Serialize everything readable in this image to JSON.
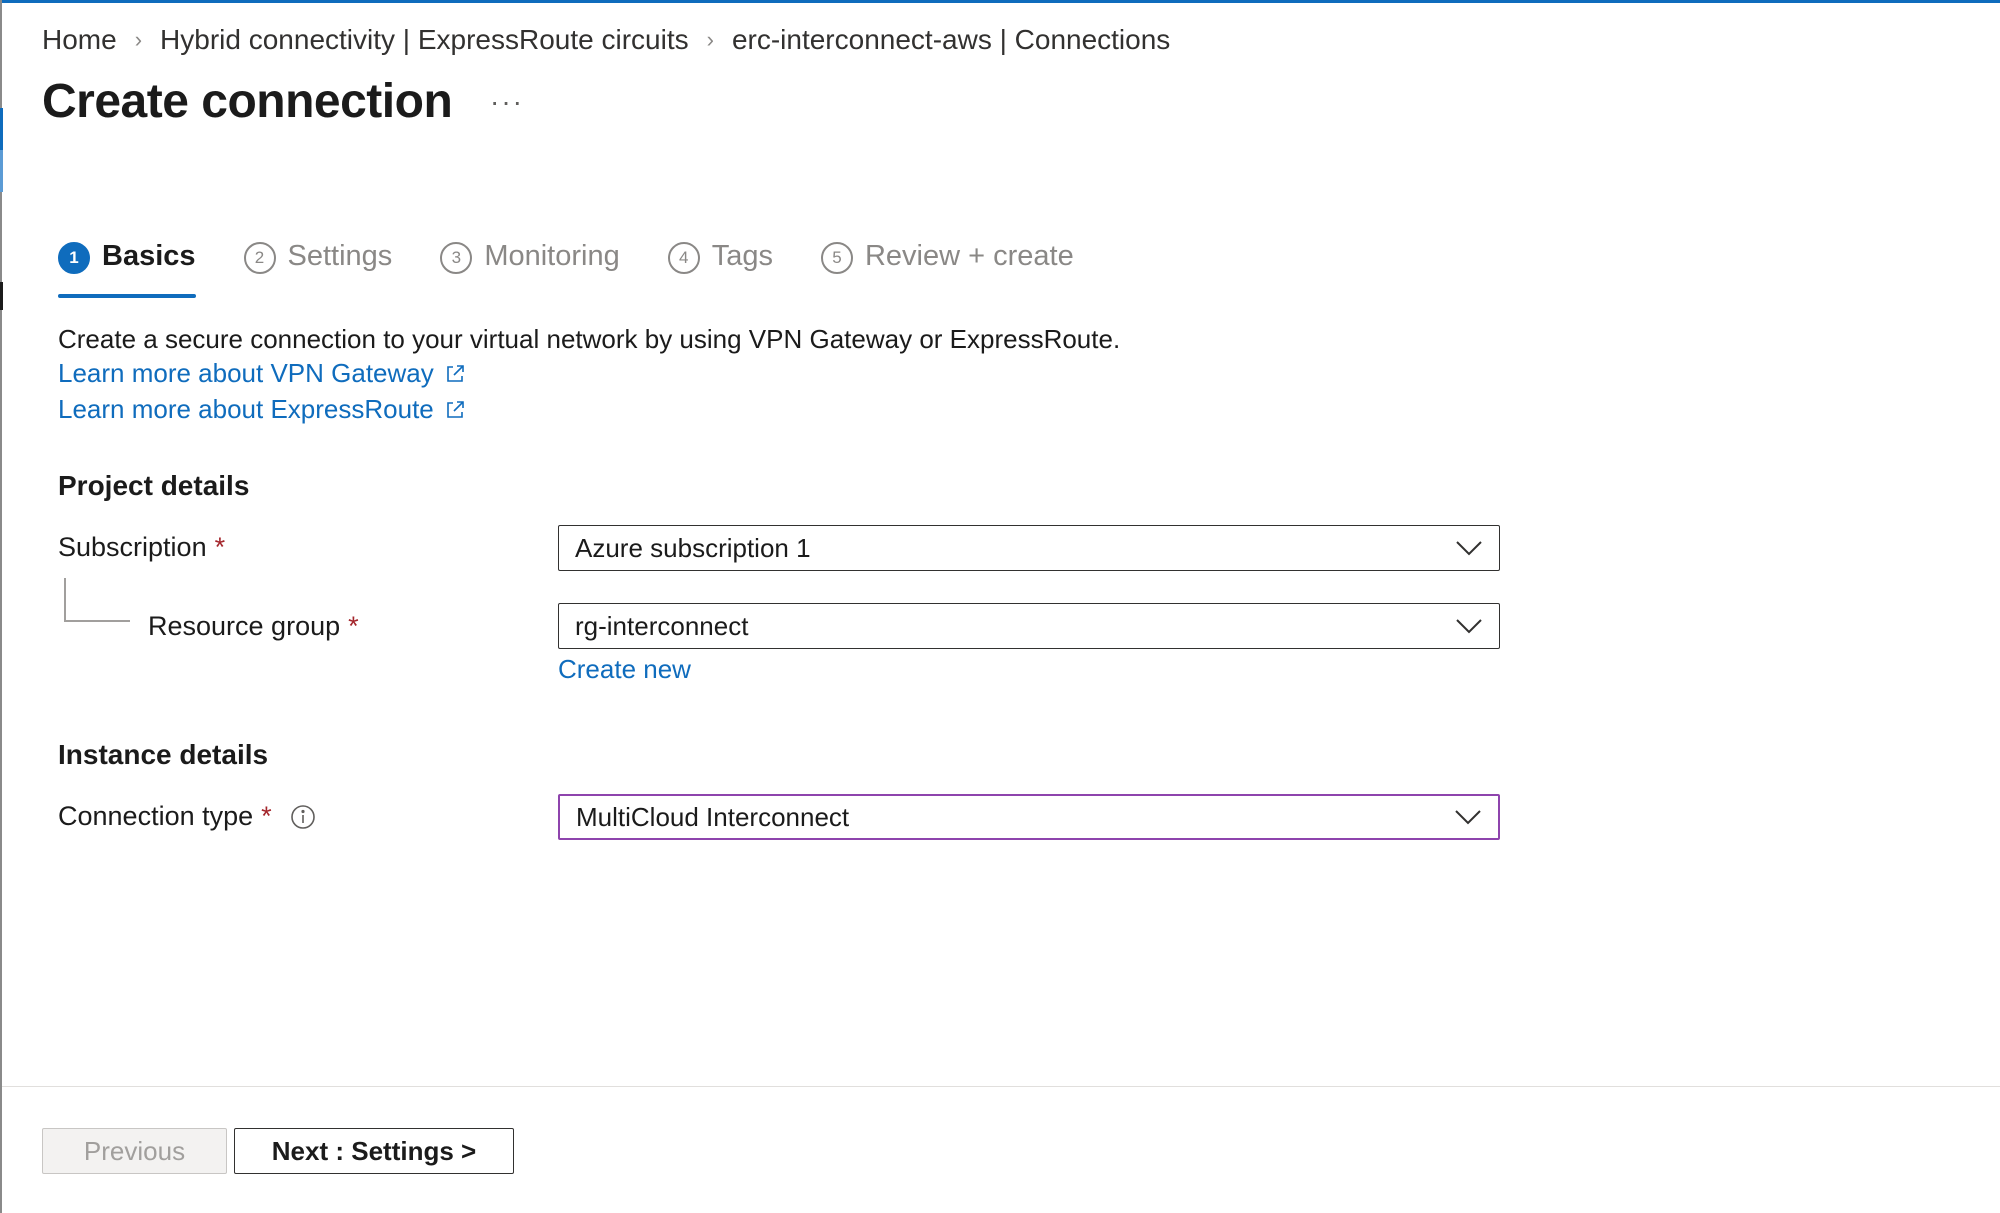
{
  "breadcrumb": {
    "items": [
      "Home",
      "Hybrid connectivity | ExpressRoute circuits",
      "erc-interconnect-aws | Connections"
    ],
    "separator": "›"
  },
  "page": {
    "title": "Create connection",
    "more_label": "···"
  },
  "tabs": [
    {
      "number": "1",
      "label": "Basics",
      "active": true
    },
    {
      "number": "2",
      "label": "Settings",
      "active": false
    },
    {
      "number": "3",
      "label": "Monitoring",
      "active": false
    },
    {
      "number": "4",
      "label": "Tags",
      "active": false
    },
    {
      "number": "5",
      "label": "Review + create",
      "active": false
    }
  ],
  "intro": {
    "description": "Create a secure connection to your virtual network by using VPN Gateway or ExpressRoute.",
    "links": [
      "Learn more about VPN Gateway",
      "Learn more about ExpressRoute"
    ]
  },
  "project_details": {
    "heading": "Project details",
    "subscription": {
      "label": "Subscription",
      "required_mark": "*",
      "value": "Azure subscription 1"
    },
    "resource_group": {
      "label": "Resource group",
      "required_mark": "*",
      "value": "rg-interconnect",
      "create_new": "Create new"
    }
  },
  "instance_details": {
    "heading": "Instance details",
    "connection_type": {
      "label": "Connection type",
      "required_mark": "*",
      "value": "MultiCloud Interconnect"
    }
  },
  "footer": {
    "previous": "Previous",
    "next": "Next : Settings >"
  },
  "colors": {
    "accent": "#0f6cbd",
    "required": "#a4262c",
    "focus_border": "#8e44ad"
  }
}
